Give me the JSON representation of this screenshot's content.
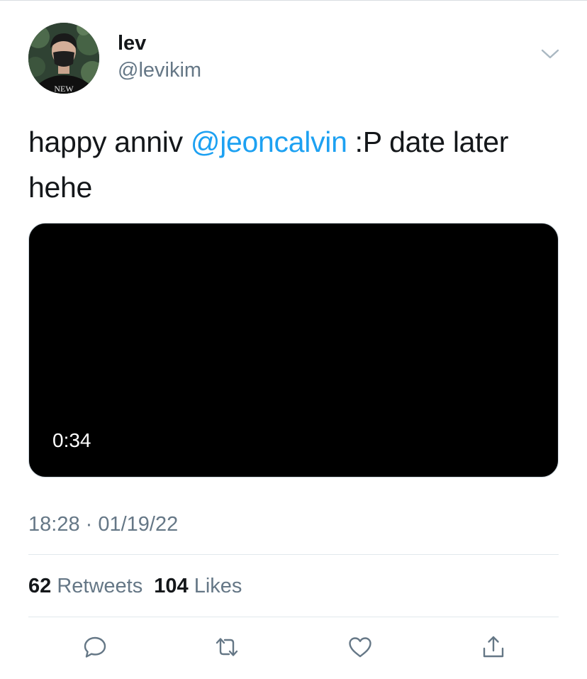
{
  "tweet": {
    "author_name": "lev",
    "author_handle": "@levikim",
    "text_before": "happy anniv ",
    "mention": "@jeoncalvin",
    "text_after": " :P date later hehe",
    "video_duration": "0:34",
    "timestamp": "18:28 · 01/19/22",
    "avatar_shirt_text": "NEW"
  },
  "stats": {
    "retweets_count": "62",
    "retweets_label": "Retweets",
    "likes_count": "104",
    "likes_label": "Likes"
  },
  "icons": {
    "caret": "chevron-down-icon",
    "reply": "reply-icon",
    "retweet": "retweet-icon",
    "like": "heart-icon",
    "share": "share-icon"
  },
  "colors": {
    "link": "#1da1f2",
    "secondary_text": "#657786",
    "primary_text": "#14171a",
    "media_background": "#000000"
  }
}
